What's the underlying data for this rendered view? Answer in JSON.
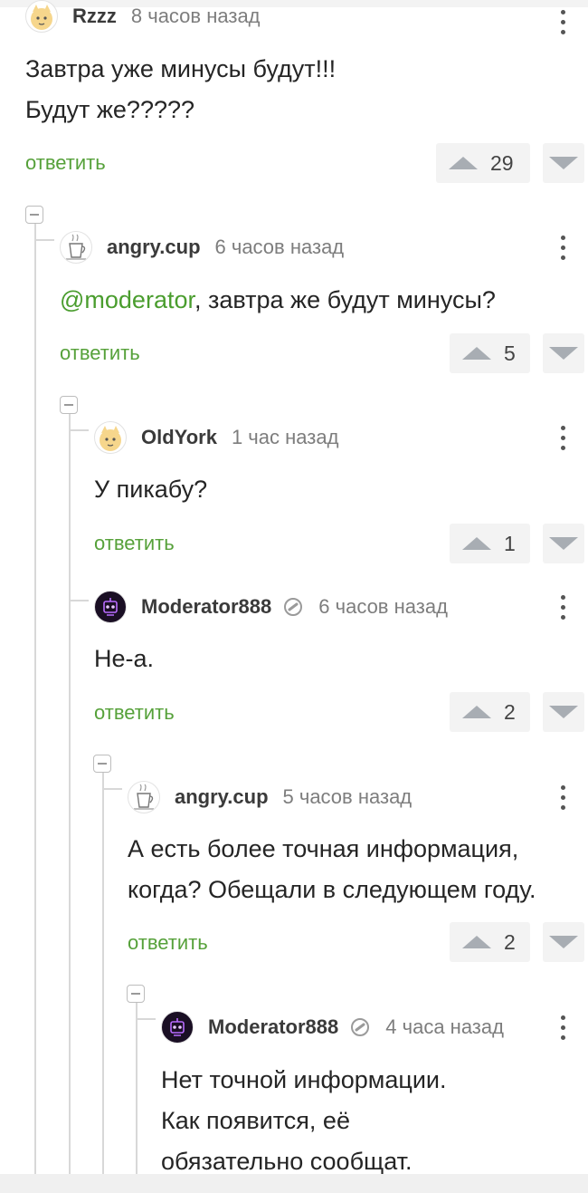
{
  "comments": [
    {
      "user": "Rzzz",
      "time": "8 часов назад",
      "lines": [
        "Завтра уже минусы будут!!!",
        "Будут же?????"
      ],
      "votes": "29",
      "reply": "ответить",
      "avatar_icon": "cat-avatar-icon"
    },
    {
      "user": "angry.cup",
      "time": "6 часов назад",
      "mention": "@moderator",
      "text_after_mention": ", завтра же будут минусы?",
      "votes": "5",
      "reply": "ответить",
      "avatar_icon": "cup-avatar-icon"
    },
    {
      "user": "OldYork",
      "time": "1 час назад",
      "lines": [
        "У пикабу?"
      ],
      "votes": "1",
      "reply": "ответить",
      "avatar_icon": "cat-avatar-icon"
    },
    {
      "user": "Moderator888",
      "time": "6 часов назад",
      "lines": [
        "Не-а."
      ],
      "votes": "2",
      "reply": "ответить",
      "avatar_icon": "robot-avatar-icon",
      "badge_icon": "moderator-pin-icon"
    },
    {
      "user": "angry.cup",
      "time": "5 часов назад",
      "lines": [
        "А есть более точная информация,",
        "когда? Обещали в следующем году."
      ],
      "votes": "2",
      "reply": "ответить",
      "avatar_icon": "cup-avatar-icon"
    },
    {
      "user": "Moderator888",
      "time": "4 часа назад",
      "lines": [
        "Нет точной информации.",
        "Как появится, её",
        "обязательно сообщат."
      ],
      "avatar_icon": "robot-avatar-icon",
      "badge_icon": "moderator-pin-icon"
    }
  ],
  "colors": {
    "link_green": "#56a13a",
    "mention_green": "#4a9d2e",
    "vote_bg": "#f3f3f3",
    "arrow_gray": "#a8adb3"
  }
}
